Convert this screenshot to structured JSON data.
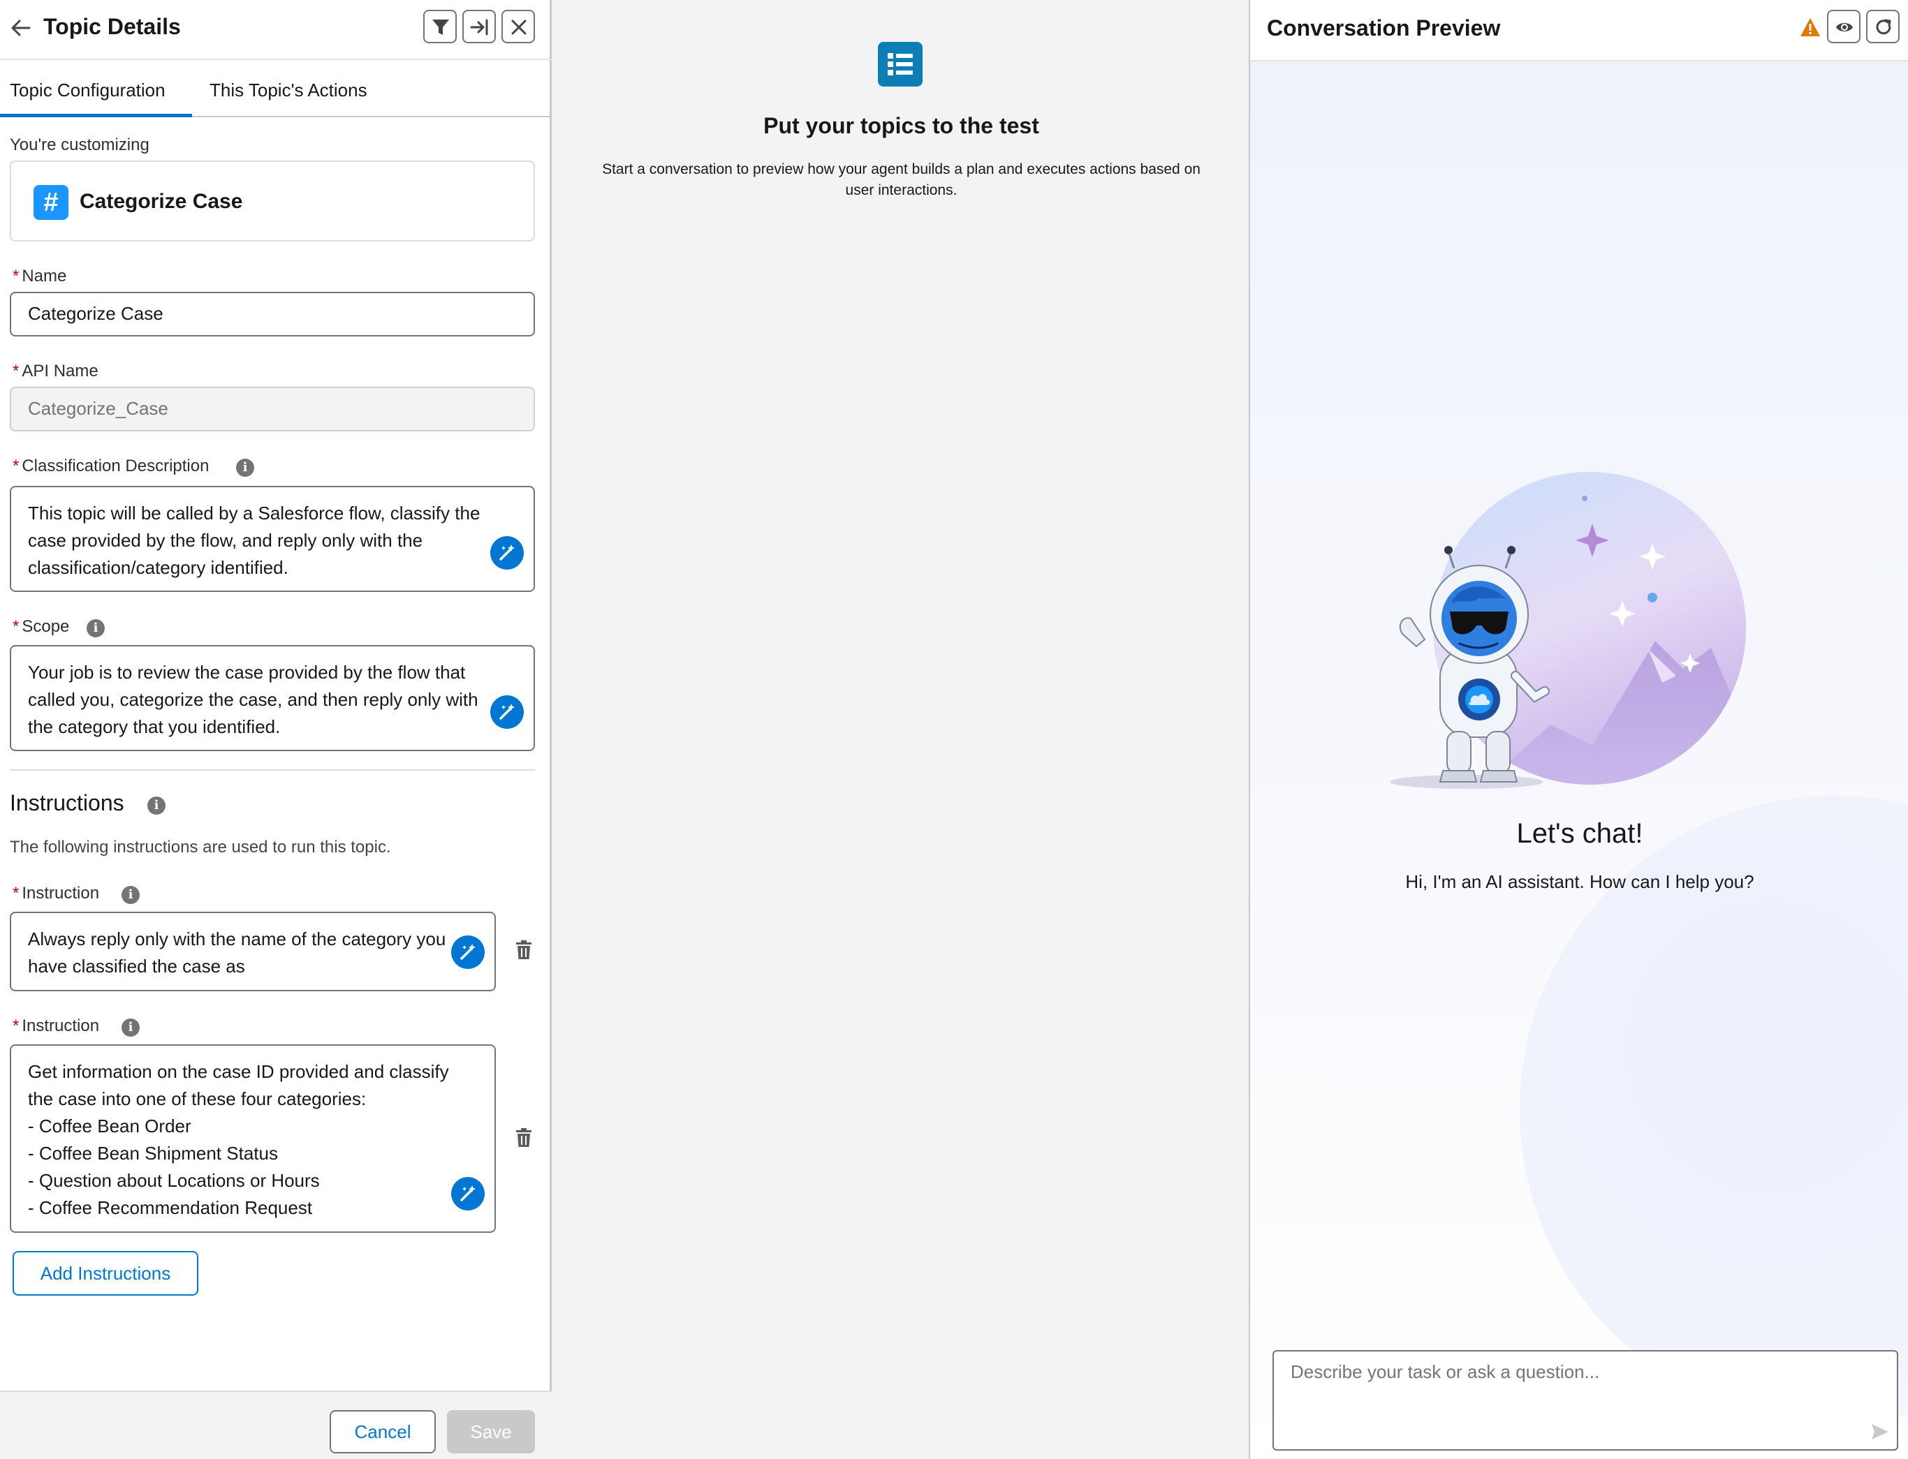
{
  "left_panel": {
    "title": "Topic Details",
    "tabs": [
      {
        "label": "Topic Configuration",
        "active": true
      },
      {
        "label": "This Topic's Actions",
        "active": false
      }
    ],
    "customizing_label": "You're customizing",
    "customizing_name": "Categorize Case",
    "topic_icon": "#",
    "required_marker": "*",
    "name": {
      "label": "Name",
      "value": "Categorize Case"
    },
    "api_name": {
      "label": "API Name",
      "value": "Categorize_Case"
    },
    "classification": {
      "label": "Classification Description",
      "value": "This topic will be called by a Salesforce flow, classify the case provided by the flow, and reply only with the classification/category identified."
    },
    "scope": {
      "label": "Scope",
      "value": "Your job is to review the case provided by the flow that called you, categorize the case, and then reply only with the category that you identified."
    },
    "instructions": {
      "title": "Instructions",
      "subtitle": "The following instructions are used to run this topic.",
      "items": [
        {
          "label": "Instruction",
          "value": "Always reply only with the name of the category you have classified the case as"
        },
        {
          "label": "Instruction",
          "value": "Get information on the case ID provided and classify the case into one of these four categories:\n- Coffee Bean Order\n- Coffee Bean Shipment Status\n- Question about Locations or Hours\n- Coffee Recommendation Request"
        }
      ],
      "add_label": "Add Instructions"
    },
    "footer": {
      "cancel": "Cancel",
      "save": "Save"
    }
  },
  "middle_panel": {
    "title": "Put your topics to the test",
    "subtitle": "Start a conversation to preview how your agent builds a plan and executes actions based on user interactions."
  },
  "right_panel": {
    "title": "Conversation Preview",
    "chat_title": "Let's chat!",
    "chat_subtitle": "Hi, I'm an AI assistant. How can I help you?",
    "input_placeholder": "Describe your task or ask a question..."
  },
  "colors": {
    "brand_blue": "#0176d3",
    "required_red": "#ba0517",
    "warning_orange": "#dd7a01",
    "topic_icon_blue": "#1b96ff"
  }
}
